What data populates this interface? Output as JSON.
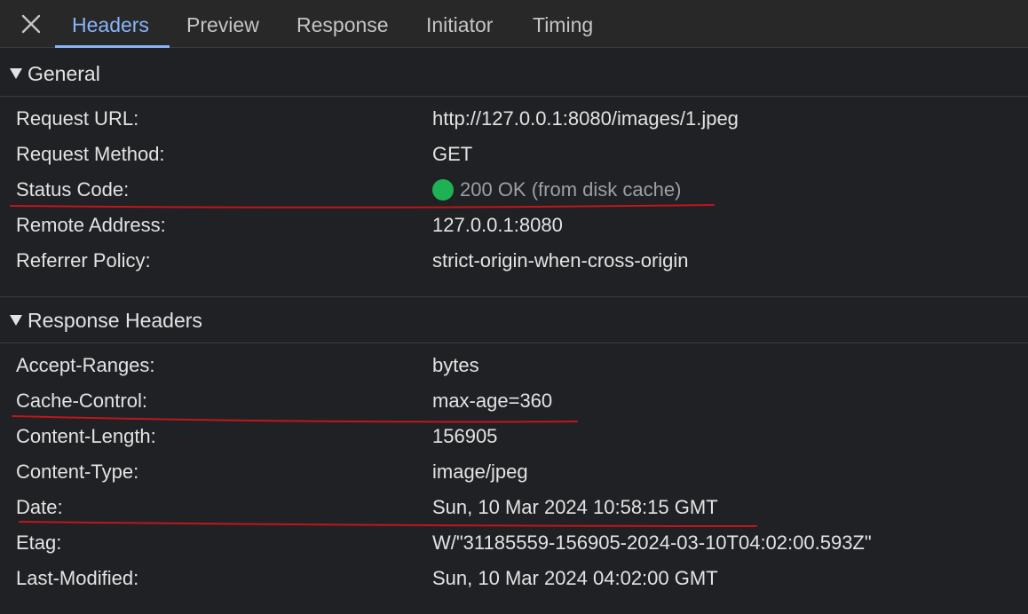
{
  "tabs": [
    {
      "label": "Headers",
      "active": true
    },
    {
      "label": "Preview",
      "active": false
    },
    {
      "label": "Response",
      "active": false
    },
    {
      "label": "Initiator",
      "active": false
    },
    {
      "label": "Timing",
      "active": false
    }
  ],
  "general": {
    "title": "General",
    "rows": [
      {
        "key": "Request URL:",
        "value": "http://127.0.0.1:8080/images/1.jpeg"
      },
      {
        "key": "Request Method:",
        "value": "GET"
      },
      {
        "key": "Status Code:",
        "value": "200 OK (from disk cache)"
      },
      {
        "key": "Remote Address:",
        "value": "127.0.0.1:8080"
      },
      {
        "key": "Referrer Policy:",
        "value": "strict-origin-when-cross-origin"
      }
    ]
  },
  "response_headers": {
    "title": "Response Headers",
    "rows": [
      {
        "key": "Accept-Ranges:",
        "value": "bytes"
      },
      {
        "key": "Cache-Control:",
        "value": "max-age=360"
      },
      {
        "key": "Content-Length:",
        "value": "156905"
      },
      {
        "key": "Content-Type:",
        "value": "image/jpeg"
      },
      {
        "key": "Date:",
        "value": "Sun, 10 Mar 2024 10:58:15 GMT"
      },
      {
        "key": "Etag:",
        "value": "W/\"31185559-156905-2024-03-10T04:02:00.593Z\""
      },
      {
        "key": "Last-Modified:",
        "value": "Sun, 10 Mar 2024 04:02:00 GMT"
      }
    ]
  },
  "icons": {
    "close": "close-icon",
    "expand": "triangle-down-icon",
    "status": "status-dot-icon"
  },
  "colors": {
    "accent": "#8ab4f8",
    "status_ok": "#1fb254",
    "annotation": "#c0161b"
  }
}
